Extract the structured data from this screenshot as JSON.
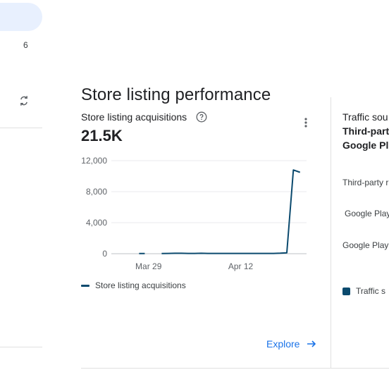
{
  "sidebar": {
    "count_badge": "6"
  },
  "section": {
    "title": "Store listing performance"
  },
  "card": {
    "metric_label": "Store listing acquisitions",
    "metric_value": "21.5K",
    "explore_label": "Explore",
    "legend_label": "Store listing acquisitions"
  },
  "right_panel": {
    "heading": "Traffic sou",
    "sub_line1": "Third-part",
    "sub_line2": "Google Pl",
    "rows": [
      "Third-party r",
      "Google Play",
      "Google Play"
    ],
    "legend_label": "Traffic s"
  },
  "chart_data": {
    "type": "line",
    "title": "",
    "xlabel": "",
    "ylabel": "",
    "ylim": [
      0,
      12000
    ],
    "y_ticks": [
      "12,000",
      "8,000",
      "4,000",
      "0"
    ],
    "x_tick_labels": [
      "Mar 29",
      "Apr 12"
    ],
    "series": [
      {
        "name": "Store listing acquisitions",
        "color": "#0b4a6e",
        "x": [
          "Mar 24",
          "Mar 25",
          "Mar 26",
          "Mar 27",
          "Mar 28",
          "Mar 29",
          "Mar 30",
          "Mar 31",
          "Apr 1",
          "Apr 2",
          "Apr 3",
          "Apr 4",
          "Apr 5",
          "Apr 6",
          "Apr 7",
          "Apr 8",
          "Apr 9",
          "Apr 10",
          "Apr 11",
          "Apr 12",
          "Apr 13",
          "Apr 14",
          "Apr 15",
          "Apr 16",
          "Apr 17",
          "Apr 18",
          "Apr 19",
          "Apr 20",
          "Apr 21",
          "Apr 22"
        ],
        "values": [
          null,
          null,
          null,
          null,
          20,
          null,
          null,
          30,
          40,
          50,
          50,
          40,
          40,
          50,
          40,
          40,
          40,
          40,
          40,
          40,
          40,
          40,
          40,
          40,
          40,
          60,
          120,
          10800,
          10500,
          null
        ]
      }
    ]
  },
  "colors": {
    "accent": "#1a73e8",
    "series": "#0b4a6e",
    "sidebar_active": "#e8f0fe"
  }
}
